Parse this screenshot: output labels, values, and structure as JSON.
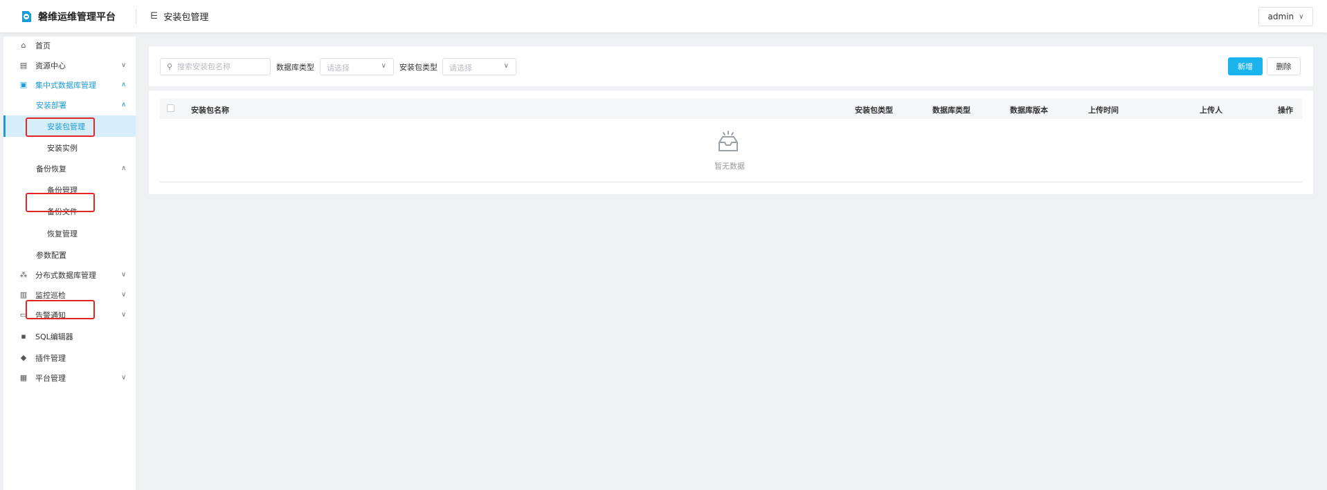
{
  "header": {
    "app_title": "磐维运维管理平台",
    "breadcrumb_icon": "menu-fold-icon",
    "breadcrumb": "安装包管理",
    "user": "admin"
  },
  "sidebar": {
    "items": [
      {
        "label": "首页",
        "icon": "home-icon"
      },
      {
        "label": "资源中心",
        "icon": "server-icon"
      },
      {
        "label": "集中式数据库管理",
        "icon": "database-icon"
      },
      {
        "label": "安装部署"
      },
      {
        "label": "安装包管理"
      },
      {
        "label": "安装实例"
      },
      {
        "label": "备份恢复"
      },
      {
        "label": "备份管理"
      },
      {
        "label": "备份文件"
      },
      {
        "label": "恢复管理"
      },
      {
        "label": "参数配置"
      },
      {
        "label": "分布式数据库管理",
        "icon": "cluster-icon"
      },
      {
        "label": "监控巡检",
        "icon": "chart-icon"
      },
      {
        "label": "告警通知",
        "icon": "monitor-icon"
      },
      {
        "label": "SQL编辑器",
        "icon": "terminal-icon"
      },
      {
        "label": "插件管理",
        "icon": "plugin-icon"
      },
      {
        "label": "平台管理",
        "icon": "platform-icon"
      }
    ]
  },
  "toolbar": {
    "search_placeholder": "搜索安装包名称",
    "db_type_label": "数据库类型",
    "db_type_placeholder": "请选择",
    "pkg_type_label": "安装包类型",
    "pkg_type_placeholder": "请选择",
    "add_label": "新增",
    "delete_label": "删除"
  },
  "table": {
    "columns": [
      "安装包名称",
      "安装包类型",
      "数据库类型",
      "数据库版本",
      "上传时间",
      "上传人",
      "操作"
    ],
    "rows": [],
    "empty_text": "暂无数据"
  },
  "colors": {
    "accent": "#1a9bd7",
    "primary_button": "#1ab3ee",
    "highlight_box": "#e52424",
    "selected_bg": "#d6edfa"
  }
}
